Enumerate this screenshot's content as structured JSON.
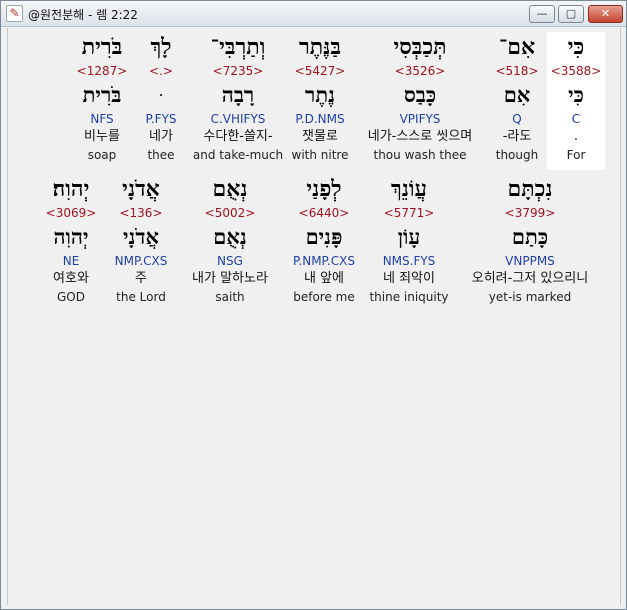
{
  "window": {
    "title": "@원전분해 - 렘 2:22",
    "icon": "app-logo-icon",
    "controls": {
      "minimize": "—",
      "maximize": "▢",
      "close": "✕"
    }
  },
  "rows": [
    {
      "words": [
        {
          "id": "w1",
          "heb": "כִּי",
          "strong": "<3588>",
          "lemma": "כִּי",
          "morph": "C",
          "kor": ".",
          "eng": "For",
          "highlight": true
        },
        {
          "id": "w2",
          "heb": "אִם־",
          "strong": "<518>",
          "lemma": "אִם",
          "morph": "Q",
          "kor": "-라도",
          "eng": "though"
        },
        {
          "id": "w3",
          "heb": "תְּכַבְּסִי",
          "strong": "<3526>",
          "lemma": "כָּבַס",
          "morph": "VPIFYS",
          "kor": "네가-스스로 씻으며",
          "eng": "thou wash thee"
        },
        {
          "id": "w4",
          "heb": "בַּנֶּתֶר",
          "strong": "<5427>",
          "lemma": "נֶתֶר",
          "morph": "P.D.NMS",
          "kor": "잿물로",
          "eng": "with nitre"
        },
        {
          "id": "w5",
          "heb": "וְתַרְבִּי־",
          "strong": "<7235>",
          "lemma": "רָבָה",
          "morph": "C.VHIFYS",
          "kor": "수다한-쓸지-",
          "eng": "and take-much"
        },
        {
          "id": "w6",
          "heb": "לָךְ",
          "strong": "<.>",
          "lemma": "ּ",
          "morph": "P.FYS",
          "kor": "네가",
          "eng": "thee"
        },
        {
          "id": "w7",
          "heb": "בֹּרִית",
          "strong": "<1287>",
          "lemma": "בֹּרִית",
          "morph": "NFS",
          "kor": "비누를",
          "eng": "soap"
        }
      ]
    },
    {
      "words": [
        {
          "id": "w8",
          "heb": "נִכְתָּם",
          "strong": "<3799>",
          "lemma": "כָּתַם",
          "morph": "VNPPMS",
          "kor": "오히려-그저 있으리니",
          "eng": "yet-is marked"
        },
        {
          "id": "w9",
          "heb": "עֲוֹנֵךְ",
          "strong": "<5771>",
          "lemma": "עָוֹן",
          "morph": "NMS.FYS",
          "kor": "네 죄악이",
          "eng": "thine iniquity"
        },
        {
          "id": "w10",
          "heb": "לְפָנַי",
          "strong": "<6440>",
          "lemma": "פָּנִים",
          "morph": "P.NMP.CXS",
          "kor": "내 앞에",
          "eng": "before me"
        },
        {
          "id": "w11",
          "heb": "נְאֻם",
          "strong": "<5002>",
          "lemma": "נְאֻם",
          "morph": "NSG",
          "kor": "내가 말하노라",
          "eng": "saith"
        },
        {
          "id": "w12",
          "heb": "אֲדֹנָי",
          "strong": "<136>",
          "lemma": "אֲדֹנָי",
          "morph": "NMP.CXS",
          "kor": "주",
          "eng": "the Lord"
        },
        {
          "id": "w13",
          "heb": "יְהוִה׃",
          "strong": "<3069>",
          "lemma": "יְהוִה",
          "morph": "NE",
          "kor": "여호와",
          "eng": "GOD"
        }
      ]
    }
  ],
  "colors": {
    "strong": "#a0121e",
    "morph": "#1f3fa8",
    "highlight": "#ffffff"
  }
}
